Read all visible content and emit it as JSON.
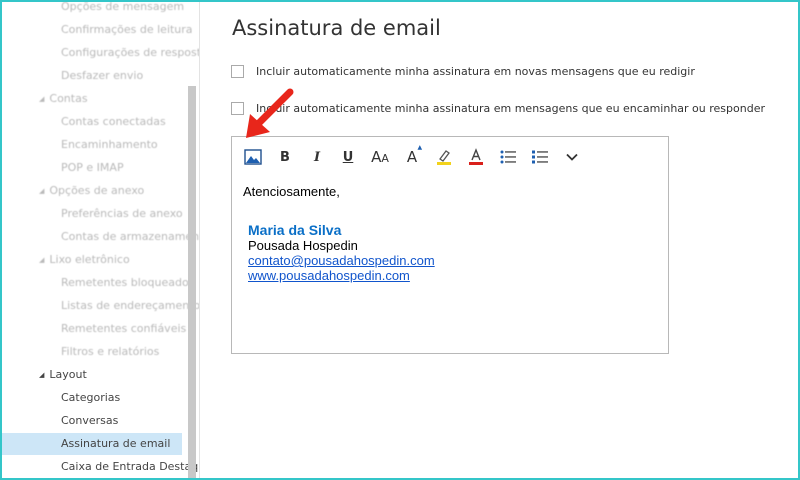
{
  "sidebar": {
    "items": [
      {
        "label": "Opções de mensagem",
        "type": "child",
        "faded": true
      },
      {
        "label": "Confirmações de leitura",
        "type": "child",
        "faded": true
      },
      {
        "label": "Configurações de resposta",
        "type": "child",
        "faded": true
      },
      {
        "label": "Desfazer envio",
        "type": "child",
        "faded": true
      },
      {
        "label": "Contas",
        "type": "group",
        "faded": true
      },
      {
        "label": "Contas conectadas",
        "type": "child",
        "faded": true
      },
      {
        "label": "Encaminhamento",
        "type": "child",
        "faded": true
      },
      {
        "label": "POP e IMAP",
        "type": "child",
        "faded": true
      },
      {
        "label": "Opções de anexo",
        "type": "group",
        "faded": true
      },
      {
        "label": "Preferências de anexo",
        "type": "child",
        "faded": true
      },
      {
        "label": "Contas de armazenamento",
        "type": "child",
        "faded": true
      },
      {
        "label": "Lixo eletrônico",
        "type": "group",
        "faded": true
      },
      {
        "label": "Remetentes bloqueados",
        "type": "child",
        "faded": true
      },
      {
        "label": "Listas de endereçamento",
        "type": "child",
        "faded": true
      },
      {
        "label": "Remetentes confiáveis",
        "type": "child",
        "faded": true
      },
      {
        "label": "Filtros e relatórios",
        "type": "child",
        "faded": true
      },
      {
        "label": "Layout",
        "type": "group",
        "faded": false
      },
      {
        "label": "Categorias",
        "type": "child",
        "faded": false
      },
      {
        "label": "Conversas",
        "type": "child",
        "faded": false
      },
      {
        "label": "Assinatura de email",
        "type": "child",
        "faded": false,
        "selected": true
      },
      {
        "label": "Caixa de Entrada Destaques",
        "type": "child",
        "faded": false
      }
    ]
  },
  "page": {
    "title": "Assinatura de email",
    "option_new": "Incluir automaticamente minha assinatura em novas mensagens que eu redigir",
    "option_reply": "Incluir automaticamente minha assinatura em mensagens que eu encaminhar ou responder"
  },
  "toolbar": {
    "bold": "B",
    "italic": "I",
    "underline": "U",
    "font_size": "A",
    "font_size_small": "A",
    "grow": "A"
  },
  "signature": {
    "greeting": "Atenciosamente,",
    "name": "Maria da Silva",
    "company": "Pousada Hospedin",
    "email": "contato@pousadahospedin.com",
    "website": "www.pousadahospedin.com"
  },
  "colors": {
    "accent": "#0a6fc7",
    "selected": "#cde6f7",
    "arrow": "#e8261b",
    "frame": "#34c6c9"
  }
}
